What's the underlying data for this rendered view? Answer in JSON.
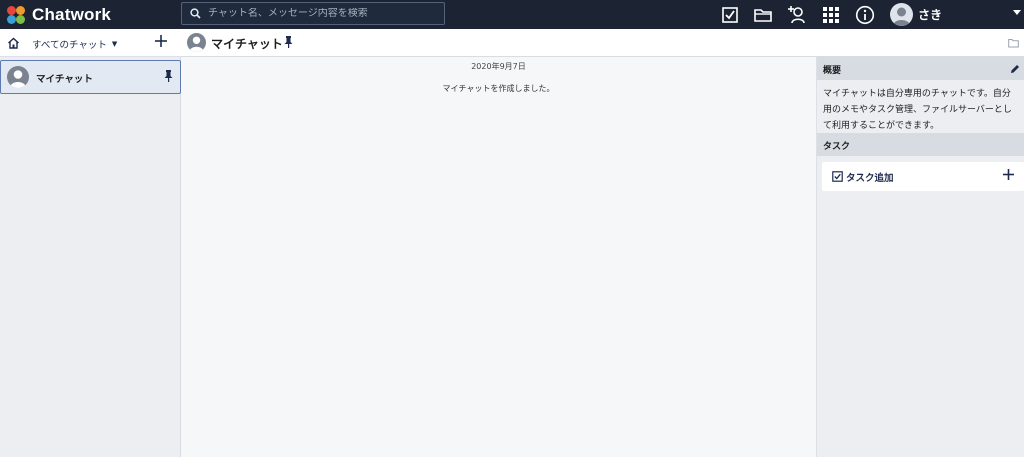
{
  "app": {
    "brand": "Chatwork",
    "brand_colors": [
      "#e8463c",
      "#f09a29",
      "#3aa0d8",
      "#7bbf44"
    ]
  },
  "header": {
    "search_placeholder": "チャット名、メッセージ内容を検索",
    "icons": [
      "task-check-icon",
      "folder-icon",
      "add-contact-icon",
      "apps-grid-icon",
      "info-icon"
    ],
    "user": {
      "name": "さき"
    }
  },
  "sidebar": {
    "filter_label": "すべてのチャット",
    "rooms": [
      {
        "name": "マイチャット",
        "pinned": true,
        "selected": true
      }
    ]
  },
  "room": {
    "title": "マイチャット",
    "messages": [
      {
        "date": "2020年9月7日",
        "text": "マイチャットを作成しました。"
      }
    ]
  },
  "right_panel": {
    "overview_title": "概要",
    "overview_text": "マイチャットは自分専用のチャットです。自分用のメモやタスク管理、ファイルサーバーとして利用することができます。",
    "task_title": "タスク",
    "add_task_label": "タスク追加"
  },
  "colors": {
    "topbar": "#1c2433",
    "accent": "#1d2a4d",
    "selected_border": "#5d7bb0"
  }
}
